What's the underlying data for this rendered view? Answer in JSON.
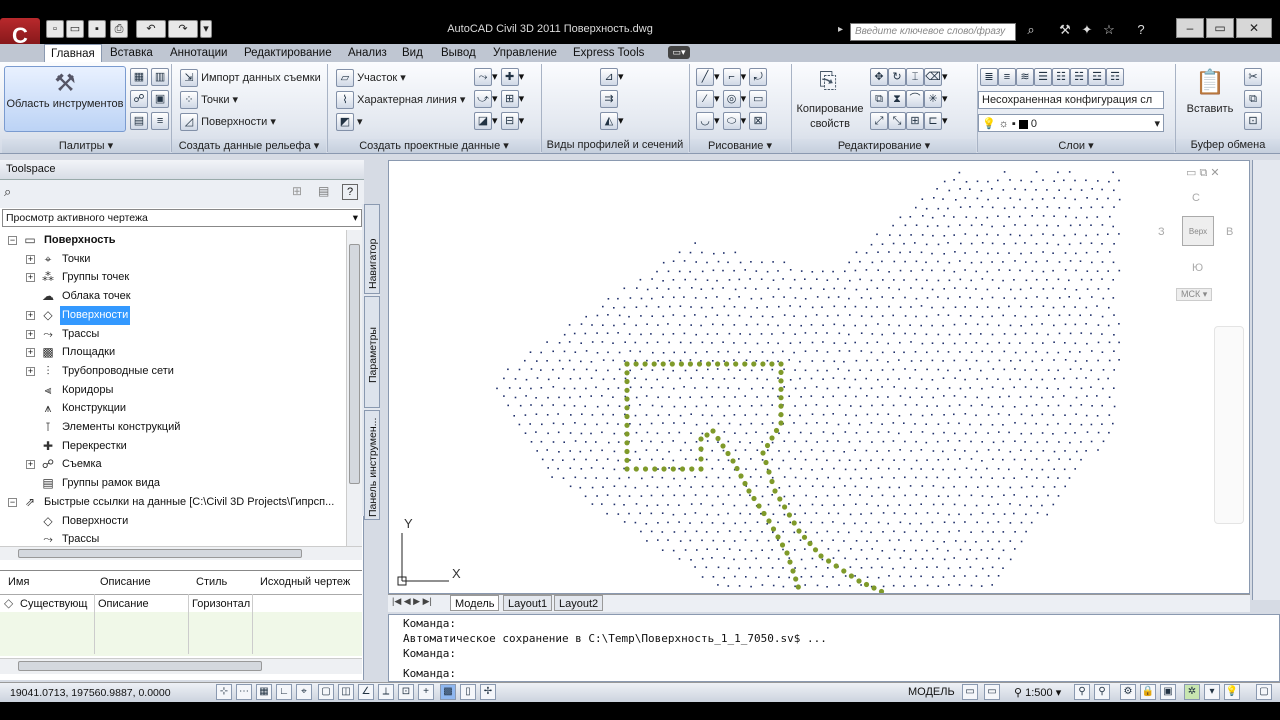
{
  "app": {
    "title": "AutoCAD Civil 3D 2011   Поверхность.dwg",
    "logo_text": "C",
    "search_placeholder": "Введите ключевое слово/фразу"
  },
  "tabs": [
    "Главная",
    "Вставка",
    "Аннотации",
    "Редактирование",
    "Анализ",
    "Вид",
    "Вывод",
    "Управление",
    "Express Tools"
  ],
  "ribbon": {
    "toolspace_button": "Область инструментов",
    "import_survey": "Импорт данных съемки",
    "points": "Точки",
    "surfaces": "Поверхности",
    "parcel": "Участок",
    "feature_line": "Характерная линия",
    "copy_props_1": "Копирование",
    "copy_props_2": "свойств",
    "layer_combo": "Несохраненная конфигурация сл",
    "layer_current": "0",
    "paste": "Вставить",
    "panels": [
      "Палитры",
      "Создать данные рельефа",
      "Создать проектные данные",
      "Виды профилей и сечений",
      "Рисование",
      "Редактирование",
      "Слои",
      "Буфер обмена"
    ]
  },
  "toolspace": {
    "title": "Toolspace",
    "combo": "Просмотр активного чертежа",
    "tree": [
      {
        "label": "Поверхность",
        "level": 0,
        "bold": true,
        "expander": "minus",
        "icon": "document-icon"
      },
      {
        "label": "Точки",
        "level": 1,
        "expander": "plus",
        "icon": "point-icon"
      },
      {
        "label": "Группы точек",
        "level": 1,
        "expander": "plus",
        "icon": "point-group-icon"
      },
      {
        "label": "Облака точек",
        "level": 1,
        "expander": "",
        "icon": "point-cloud-icon"
      },
      {
        "label": "Поверхности",
        "level": 1,
        "expander": "plus",
        "icon": "surface-icon",
        "selected": true
      },
      {
        "label": "Трассы",
        "level": 1,
        "expander": "plus",
        "icon": "alignment-icon"
      },
      {
        "label": "Площадки",
        "level": 1,
        "expander": "plus",
        "icon": "site-icon"
      },
      {
        "label": "Трубопроводные сети",
        "level": 1,
        "expander": "plus",
        "icon": "pipe-network-icon"
      },
      {
        "label": "Коридоры",
        "level": 1,
        "expander": "",
        "icon": "corridor-icon"
      },
      {
        "label": "Конструкции",
        "level": 1,
        "expander": "",
        "icon": "assembly-icon"
      },
      {
        "label": "Элементы конструкций",
        "level": 1,
        "expander": "",
        "icon": "subassembly-icon"
      },
      {
        "label": "Перекрестки",
        "level": 1,
        "expander": "",
        "icon": "intersection-icon"
      },
      {
        "label": "Съемка",
        "level": 1,
        "expander": "plus",
        "icon": "survey-icon"
      },
      {
        "label": "Группы рамок вида",
        "level": 1,
        "expander": "",
        "icon": "view-frame-icon"
      },
      {
        "label": "Быстрые ссылки на данные [C:\\Civil 3D Projects\\Гипрсп...",
        "level": 0,
        "bold": false,
        "expander": "minus",
        "icon": "shortcut-icon"
      },
      {
        "label": "Поверхности",
        "level": 1,
        "expander": "",
        "icon": "surface-icon"
      },
      {
        "label": "Трассы",
        "level": 1,
        "expander": "",
        "icon": "alignment-icon"
      }
    ],
    "side_tabs": [
      "Навигатор",
      "Параметры",
      "Панель инструмен..."
    ],
    "grid": {
      "headers": [
        "Имя",
        "Описание",
        "Стиль",
        "Исходный чертеж"
      ],
      "row": [
        "Существующ",
        "Описание",
        "Горизонтал",
        ""
      ]
    }
  },
  "viewcube": {
    "north": "С",
    "south": "Ю",
    "west": "З",
    "east": "В",
    "top": "Верх",
    "wcs": "МСК"
  },
  "axis": {
    "x": "X",
    "y": "Y"
  },
  "layout_tabs": [
    "Модель",
    "Layout1",
    "Layout2"
  ],
  "command": [
    "Команда:",
    "Автоматическое сохранение в C:\\Temp\\Поверхность_1_1_7050.sv$ ...",
    "Команда:",
    "Команда:"
  ],
  "status": {
    "coords": "19041.0713, 197560.9887, 0.0000",
    "model": "МОДЕЛЬ",
    "scale": "1:500"
  },
  "colors": {
    "selection": "#3399ff",
    "outline": "#7f9a2a",
    "points": "#1e2f6a"
  }
}
